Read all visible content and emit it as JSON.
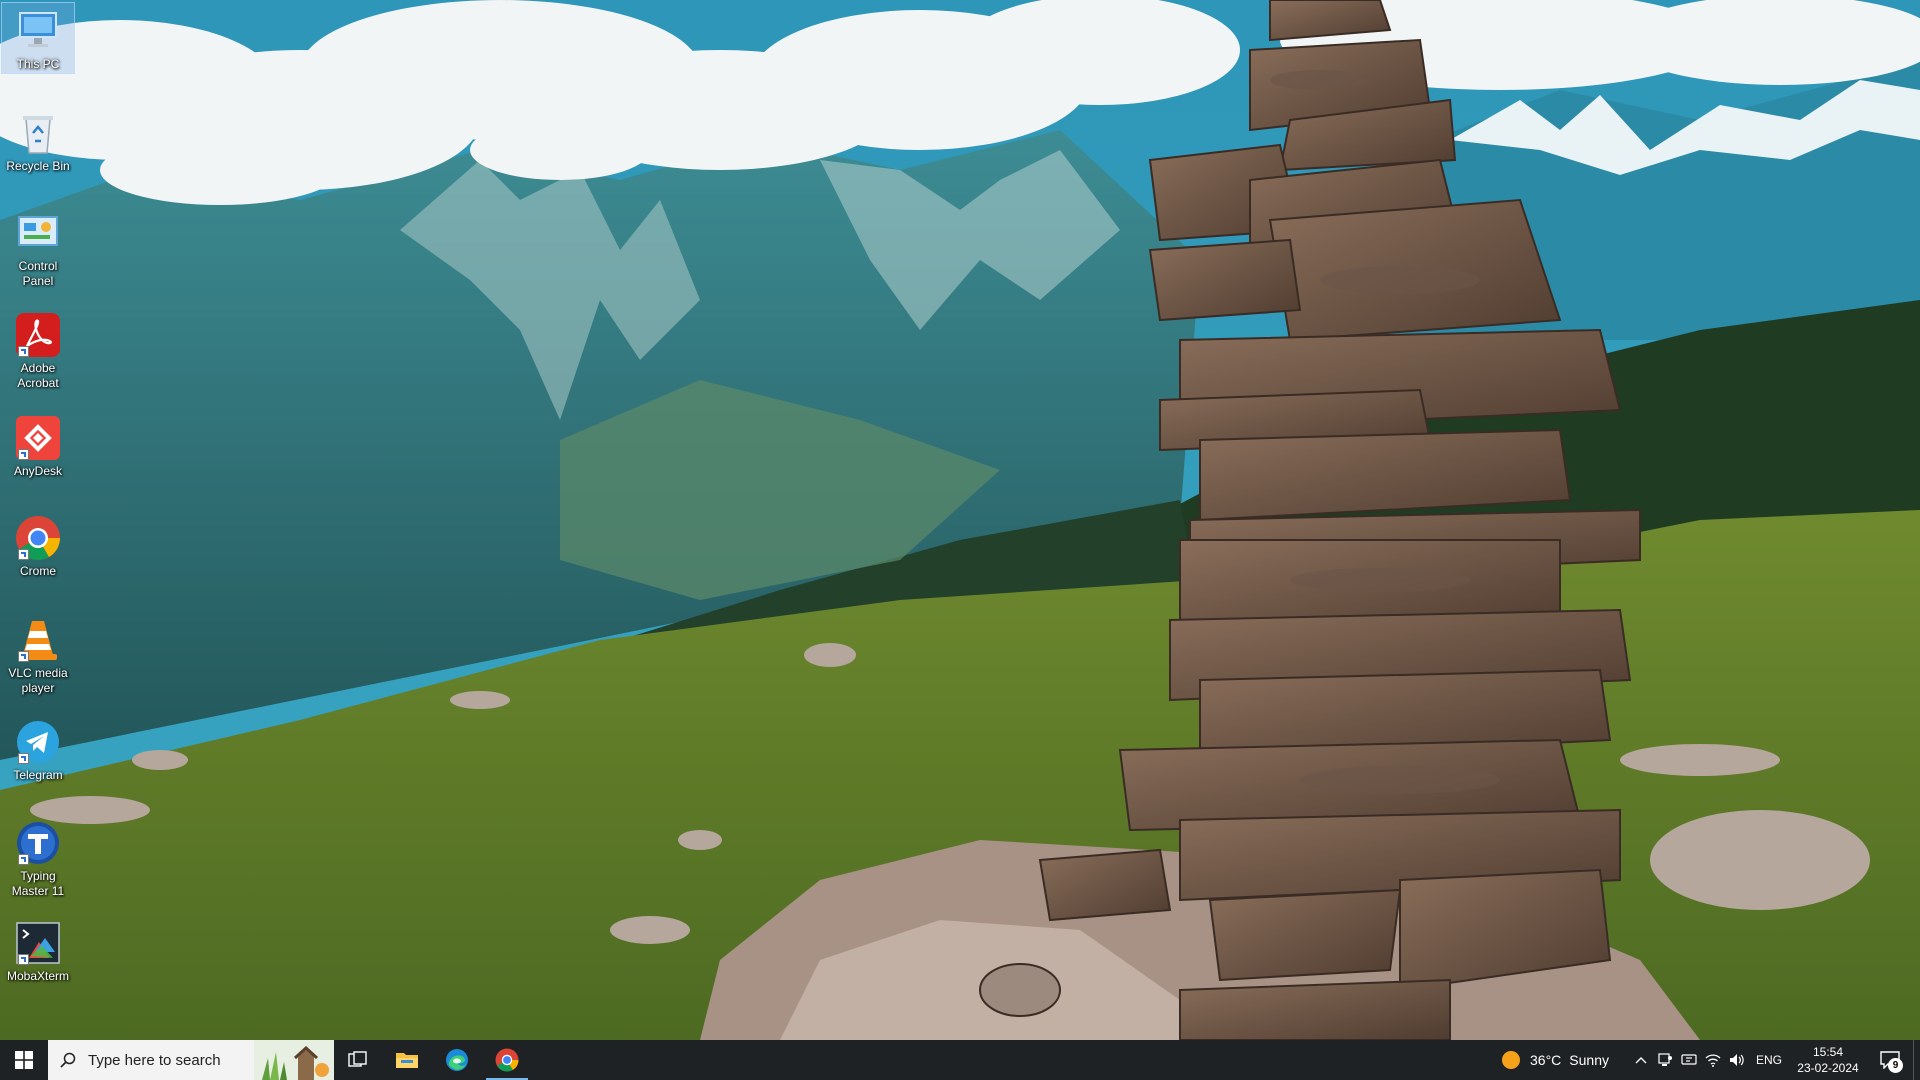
{
  "desktop": {
    "icons": [
      {
        "label": "This PC",
        "icon": "this-pc-icon",
        "selected": true
      },
      {
        "label": "Recycle Bin",
        "icon": "recycle-bin-icon"
      },
      {
        "label": "Control Panel",
        "icon": "control-panel-icon"
      },
      {
        "label": "Adobe Acrobat",
        "icon": "adobe-acrobat-icon"
      },
      {
        "label": "AnyDesk",
        "icon": "anydesk-icon"
      },
      {
        "label": "Crome",
        "icon": "chrome-icon"
      },
      {
        "label": "VLC media player",
        "icon": "vlc-icon"
      },
      {
        "label": "Telegram",
        "icon": "telegram-icon"
      },
      {
        "label": "Typing Master 11",
        "icon": "typing-master-icon"
      },
      {
        "label": "MobaXterm",
        "icon": "mobaxterm-icon"
      }
    ]
  },
  "taskbar": {
    "search_placeholder": "Type here to search",
    "pinned": [
      {
        "name": "file-explorer",
        "icon": "folder-icon"
      },
      {
        "name": "edge",
        "icon": "edge-icon"
      },
      {
        "name": "chrome",
        "icon": "chrome-icon"
      }
    ],
    "weather": {
      "temp": "36°C",
      "condition": "Sunny"
    },
    "language": "ENG",
    "time": "15:54",
    "date": "23-02-2024",
    "notification_count": "9"
  },
  "colors": {
    "taskbar_bg": "#1f2224",
    "running_indicator": "#76b9ed",
    "weather_sun": "#f6a11a"
  }
}
